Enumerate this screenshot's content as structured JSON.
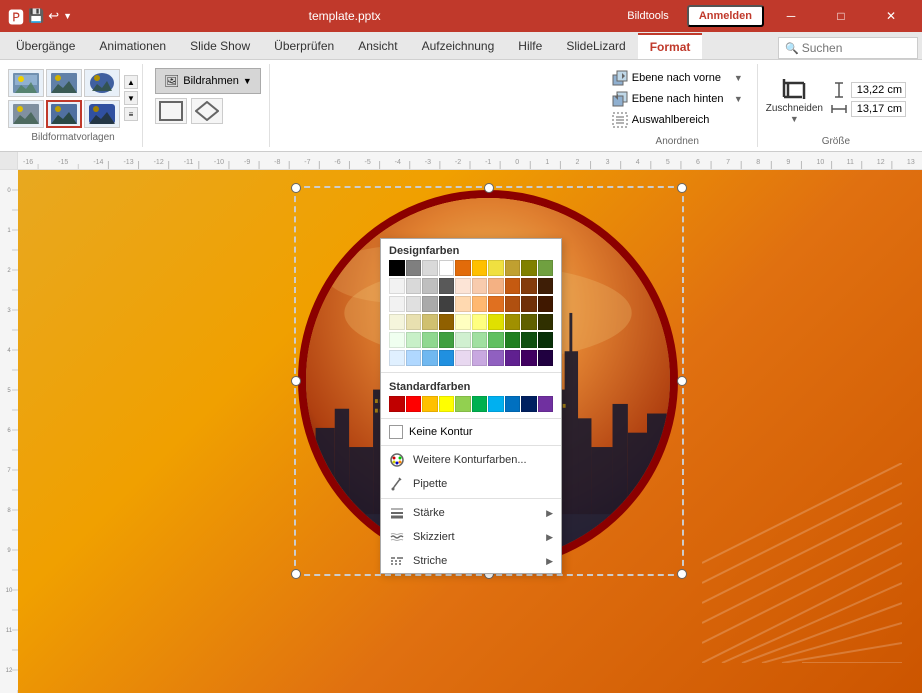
{
  "titlebar": {
    "filename": "template.pptx",
    "bildtools": "Bildtools",
    "anmelden": "Anmelden",
    "minimize": "─",
    "maximize": "□",
    "close": "✕"
  },
  "tabs": [
    {
      "label": "Übergänge",
      "active": false
    },
    {
      "label": "Animationen",
      "active": false
    },
    {
      "label": "Slide Show",
      "active": false
    },
    {
      "label": "Überprüfen",
      "active": false
    },
    {
      "label": "Ansicht",
      "active": false
    },
    {
      "label": "Aufzeichnung",
      "active": false
    },
    {
      "label": "Hilfe",
      "active": false
    },
    {
      "label": "SlideLizard",
      "active": false
    },
    {
      "label": "Format",
      "active": true
    }
  ],
  "search": {
    "placeholder": "Suchen"
  },
  "ribbon": {
    "bildformatvorlagen_label": "Bildformatvorlagen",
    "bildrahmen_btn": "Bildrahmen",
    "groups": [
      {
        "name": "anordnen",
        "label": "Anordnen",
        "buttons": [
          {
            "label": "Ebene nach vorne",
            "icon": "▲"
          },
          {
            "label": "Ebene nach hinten",
            "icon": "▼"
          },
          {
            "label": "Auswahlbereich",
            "icon": "◻"
          }
        ]
      },
      {
        "name": "groesse",
        "label": "Größe",
        "inputs": [
          {
            "label": "H",
            "value": "13,22 cm"
          },
          {
            "label": "B",
            "value": "13,17 cm"
          }
        ]
      }
    ]
  },
  "dropdown": {
    "designfarben_label": "Designfarben",
    "standardfarben_label": "Standardfarben",
    "design_colors_row1": [
      "#000000",
      "#7f7f7f",
      "#d9d9d9",
      "#ffffff",
      "#e26b0a",
      "#ffc000",
      "#f0b842",
      "#c0a030",
      "#808000",
      "#70a040"
    ],
    "design_colors_row2": [
      "#f2c590",
      "#e0a070",
      "#c88050",
      "#a86030",
      "#874020",
      "#c00000",
      "#ff0000",
      "#ff8080",
      "#ff4040",
      "#a00000"
    ],
    "design_colors_row3": [
      "#ffcc99",
      "#ffaa66",
      "#ff8833",
      "#cc6600",
      "#994400",
      "#00b050",
      "#00ff00",
      "#ccffcc",
      "#66ff66",
      "#007000"
    ],
    "design_colors_row4": [
      "#99ccff",
      "#6699ff",
      "#3366ff",
      "#0033cc",
      "#001f7f",
      "#00b0f0",
      "#00ccff",
      "#ccf2ff",
      "#66dfff",
      "#007bac"
    ],
    "design_colors_row5": [
      "#dce6f1",
      "#b8cce4",
      "#95b3d7",
      "#4f81bd",
      "#17375e",
      "#e1d0e8",
      "#cda8d8",
      "#b886c8",
      "#8064a2",
      "#603980"
    ],
    "design_colors_row6": [
      "#f2dcdb",
      "#e6b9b8",
      "#da9694",
      "#c0504d",
      "#963634",
      "#fdeada",
      "#fbcdad",
      "#f9b281",
      "#e36c09",
      "#974707"
    ],
    "standard_colors": [
      "#c00000",
      "#ff0000",
      "#ffc000",
      "#ffff00",
      "#92d050",
      "#00b050",
      "#00b0f0",
      "#0070c0",
      "#002060",
      "#7030a0"
    ],
    "no_kontur": "Keine Kontur",
    "weitere_farben": "Weitere Konturfarben...",
    "pipette": "Pipette",
    "staerke": "Stärke",
    "skizziert": "Skizziert",
    "striche": "Striche"
  },
  "slide": {
    "background_desc": "orange gradient background"
  }
}
